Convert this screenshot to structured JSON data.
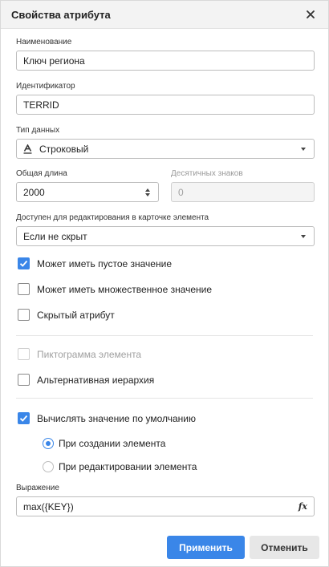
{
  "dialog": {
    "title": "Свойства атрибута",
    "close_icon": "close-icon"
  },
  "name": {
    "label": "Наименование",
    "value": "Ключ региона"
  },
  "identifier": {
    "label": "Идентификатор",
    "value": "TERRID"
  },
  "data_type": {
    "label": "Тип данных",
    "value": "Строковый",
    "icon": "string-type-icon"
  },
  "total_length": {
    "label": "Общая длина",
    "value": "2000"
  },
  "decimals": {
    "label": "Десятичных знаков",
    "value": "0",
    "disabled": true
  },
  "editable_in_card": {
    "label": "Доступен для редактирования в карточке элемента",
    "value": "Если не скрыт"
  },
  "checkboxes": [
    {
      "label": "Может иметь пустое значение",
      "checked": true
    },
    {
      "label": "Может иметь множественное значение",
      "checked": false
    },
    {
      "label": "Скрытый атрибут",
      "checked": false
    },
    {
      "label": "Пиктограмма элемента",
      "checked": false,
      "disabled": true
    },
    {
      "label": "Альтернативная иерархия",
      "checked": false
    },
    {
      "label": "Вычислять значение по умолчанию",
      "checked": true
    }
  ],
  "radios": [
    {
      "label": "При создании элемента",
      "selected": true
    },
    {
      "label": "При редактировании элемента",
      "selected": false
    }
  ],
  "expression": {
    "label": "Выражение",
    "value": "max({KEY})",
    "fx": "fx"
  },
  "buttons": {
    "apply": "Применить",
    "cancel": "Отменить"
  },
  "colors": {
    "accent": "#3a86e8",
    "header_bg": "#f3f3f3"
  }
}
